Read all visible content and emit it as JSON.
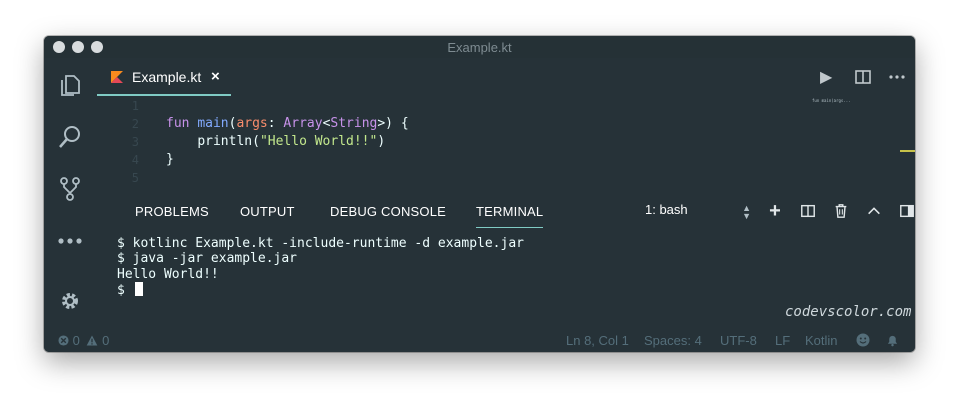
{
  "window": {
    "title": "Example.kt"
  },
  "activity_bar": {
    "items": [
      "explorer-icon",
      "search-icon",
      "source-control-icon",
      "extensions-icon",
      "settings-gear-icon"
    ]
  },
  "tab": {
    "label": "Example.kt",
    "close": "×"
  },
  "editor_actions": {
    "run": "▶"
  },
  "editor": {
    "line_numbers": [
      "1",
      "2",
      "3",
      "4",
      "5"
    ],
    "line2": {
      "kw": "fun",
      "fn": "main",
      "p1": "(",
      "param": "args",
      "colon": ": ",
      "type": "Array",
      "lt": "<",
      "type2": "String",
      "rest": ">) {"
    },
    "line3": {
      "fn": "println",
      "p1": "(",
      "str": "\"Hello World!!\"",
      "p2": ")"
    },
    "line4": "}"
  },
  "minimap_text": "fun main(args...",
  "panel": {
    "tabs": [
      "PROBLEMS",
      "OUTPUT",
      "DEBUG CONSOLE",
      "TERMINAL"
    ],
    "active_tab": "TERMINAL",
    "terminal_select": "1: bash",
    "actions": {
      "add": "+",
      "close": "×"
    }
  },
  "terminal": {
    "lines": [
      "$ kotlinc Example.kt -include-runtime -d example.jar",
      "$ java -jar example.jar",
      "Hello World!!",
      "$ "
    ]
  },
  "watermark": "codevscolor.com",
  "statusbar": {
    "errors": "0",
    "warnings": "0",
    "position": "Ln 8, Col 1",
    "spaces": "Spaces: 4",
    "encoding": "UTF-8",
    "eol": "LF",
    "language": "Kotlin"
  },
  "colors": {
    "accent": "#80cbc4",
    "background": "#263238",
    "string": "#c3e88d",
    "keyword": "#c792ea",
    "function": "#82aaff",
    "param": "#f78c6c"
  }
}
